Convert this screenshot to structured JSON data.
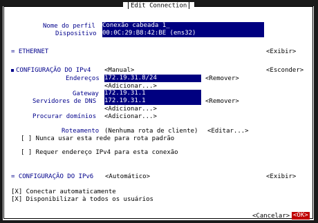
{
  "dialog": {
    "title": "Edit Connection"
  },
  "profile": {
    "name_label": "Nome do perfil",
    "name_value": "Conexão cabeada 1_",
    "device_label": "Dispositivo",
    "device_value": "00:0C:29:B8:42:BE (ens32)"
  },
  "ethernet": {
    "label": "= ETHERNET",
    "toggle": "<Exibir>"
  },
  "ipv4": {
    "label": "CONFIGURAÇÃO DO IPv4",
    "method": "<Manual>",
    "toggle": "<Esconder>",
    "addresses_label": "Endereços",
    "address_value": "172.19.31.8/24",
    "remove_label": "<Remover>",
    "add_label": "<Adicionar...>",
    "gateway_label": "Gateway",
    "gateway_value": "172.19.31.1",
    "dns_label": "Servidores de DNS",
    "dns_value": "172.19.31.1",
    "dns_remove": "<Remover>",
    "dns_add": "<Adicionar...>",
    "search_label": "Procurar domínios",
    "search_add": "<Adicionar...>",
    "routing_label": "Roteamento",
    "routing_value": "(Nenhuma rota de cliente)",
    "routing_edit": "<Editar...>",
    "never_default": "[ ] Nunca usar esta rede para rota padrão",
    "require_ipv4": "[ ] Requer endereço IPv4 para esta conexão"
  },
  "ipv6": {
    "label": "= CONFIGURAÇÃO DO IPv6",
    "method": "<Automático>",
    "toggle": "<Exibir>"
  },
  "options": {
    "autoconnect": "[X] Conectar automaticamente",
    "all_users": "[X] Disponibilizar à todos os usuários"
  },
  "buttons": {
    "cancel": "<Cancelar>",
    "ok": "<OK>"
  }
}
